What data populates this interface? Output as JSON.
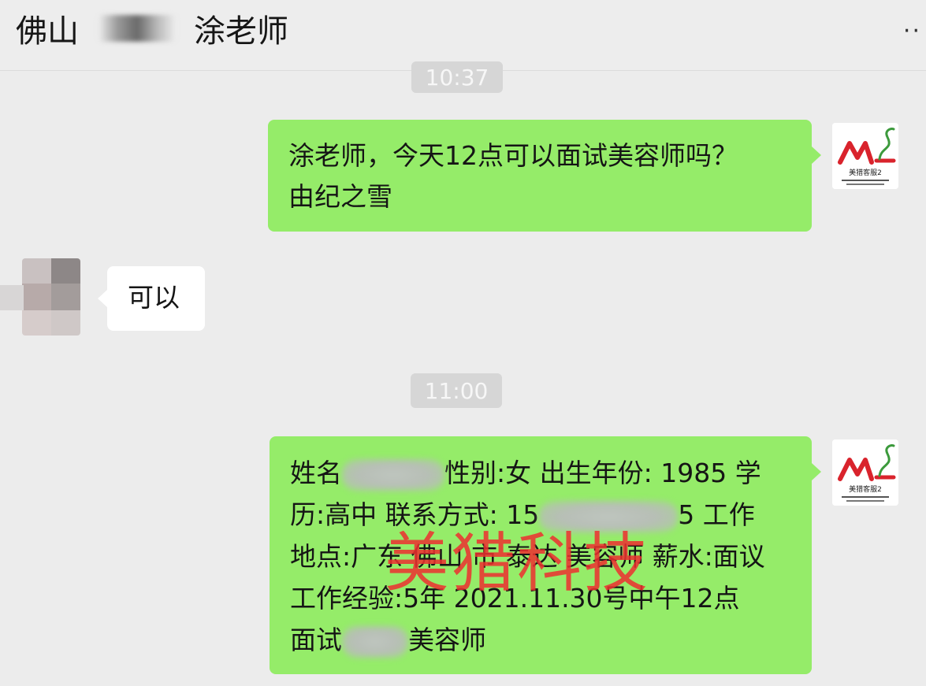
{
  "header": {
    "title_prefix": "佛山",
    "title_suffix": "涂老师",
    "more_label": "··"
  },
  "logo": {
    "mark": "ML",
    "caption": "美猎客服2"
  },
  "timestamps": [
    "10:37",
    "11:00"
  ],
  "messages": [
    {
      "side": "right",
      "lines": [
        "涂老师，今天12点可以面试美容师吗？",
        "由纪之雪"
      ]
    },
    {
      "side": "left",
      "text": "可以"
    },
    {
      "side": "right",
      "line1_a": "姓名",
      "line1_b": "性别:女 出生年份: 1985 学",
      "line2_a": "历:高中 联系方式: 15",
      "line2_b": "5 工作",
      "line3": "地点:广东 佛山 市 泰达 美容师 薪水:面议",
      "line4": " 工作经验:5年 2021.11.30号中午12点",
      "line5_a": "面试",
      "line5_b": "美容师"
    }
  ],
  "watermark": "美猎科技",
  "colors": {
    "background": "#ececec",
    "outgoing_bubble": "#95ec69",
    "incoming_bubble": "#ffffff",
    "timestamp_bg": "#d6d6d6",
    "watermark": "#ee3030"
  }
}
